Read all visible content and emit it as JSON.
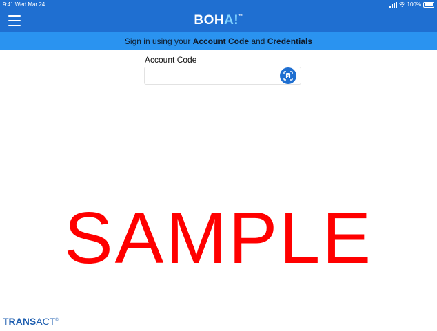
{
  "status_bar": {
    "time": "9:41 Wed Mar 24",
    "battery": "100%"
  },
  "header": {
    "logo_main": "BOH",
    "logo_accent": "A!",
    "logo_tm": "™",
    "menu_icon": "hamburger-menu-icon"
  },
  "subheader": {
    "prefix": "Sign in using your ",
    "account_code": "Account Code",
    "middle": " and ",
    "credentials": "Credentials"
  },
  "form": {
    "account_code_label": "Account Code",
    "account_code_value": "",
    "scan_icon": "scan-code-icon"
  },
  "watermark": "SAMPLE",
  "footer": {
    "brand_bold": "TRANS",
    "brand_light": "ACT",
    "brand_mark": "®"
  },
  "colors": {
    "header": "#1f6fd1",
    "subheader": "#2a93f0",
    "watermark": "#ff0000",
    "logo_accent": "#7fd2ff"
  }
}
